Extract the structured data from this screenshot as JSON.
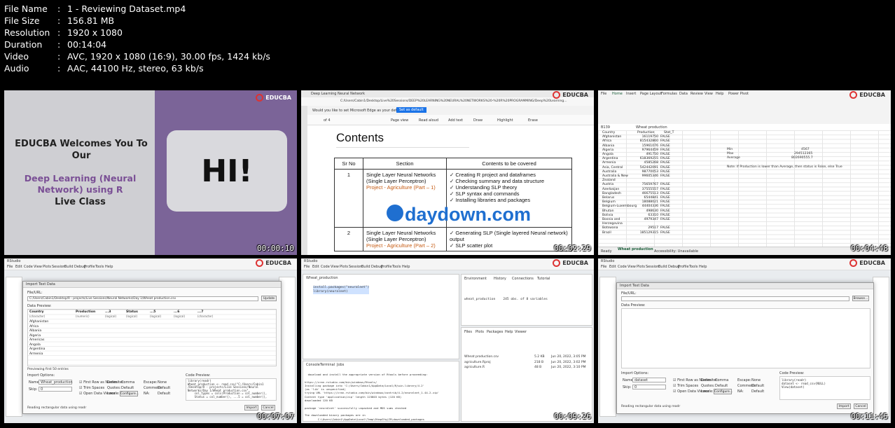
{
  "file_info": [
    {
      "key": "File Name",
      "value": "1 - Reviewing Dataset.mp4"
    },
    {
      "key": "File Size",
      "value": "156.81 MB"
    },
    {
      "key": "Resolution",
      "value": "1920 x 1080"
    },
    {
      "key": "Duration",
      "value": "00:14:04"
    },
    {
      "key": "Video",
      "value": "AVC, 1920 x 1080 (16:9), 30.00 fps, 1424 kb/s"
    },
    {
      "key": "Audio",
      "value": "AAC, 44100 Hz, stereo, 63 kb/s"
    }
  ],
  "separator": ":",
  "brand": "EDUCBA",
  "thumbnails": [
    {
      "timestamp": "00:00:10",
      "welcome": "EDUCBA Welcomes You To Our",
      "course": "Deep Learning (Neural Network) using R",
      "subtitle": "Live Class",
      "hi": "HI!"
    },
    {
      "timestamp": "00:02:29",
      "tab_title": "Deep Learning Neural Network",
      "address": "C:/Users/Cabin1/Desktop/Live%20Sessions/DEEP%20LEARNING%20NEURAL%20NETWORKS%20-%20R%20PROGRAMMING/Deep%20Learning...",
      "edge_notice": "Would you like to set Microsoft Edge as your default browser?",
      "set_default": "Set as default",
      "pdf_tools": [
        "of 4",
        "Page view",
        "Read aloud",
        "Add text",
        "Draw",
        "Highlight",
        "Erase"
      ],
      "heading": "Contents",
      "table_headers": [
        "Sr No",
        "Section",
        "Contents to be covered"
      ],
      "rows": [
        {
          "sr": "1",
          "section": "Single Layer Neural Networks (Single Layer Perceptron)",
          "section_link": "Project - Agriculture (Part – 1)",
          "contents": [
            "Creating R project and dataframes",
            "Checking summary and data structure",
            "Understanding SLP theory",
            "SLP syntax and commands",
            "Installing libraries and packages"
          ]
        },
        {
          "sr": "2",
          "section": "Single Layer Neural Networks (Single Layer Perceptron)",
          "section_link": "Project - Agriculture (Part – 2)",
          "contents": [
            "Generating SLP (Single layered Neural network) output",
            "SLP scatter plot"
          ]
        }
      ],
      "watermark": "daydown.com"
    },
    {
      "timestamp": "00:04:48",
      "ribbon_tabs": [
        "File",
        "Home",
        "Insert",
        "Page Layout",
        "Formulas",
        "Data",
        "Review",
        "View",
        "Help",
        "Power Pivot"
      ],
      "cell_ref": "B139",
      "formula": "Wheat production",
      "col_headers": [
        "Country",
        "Production",
        "Stat_T",
        "Stat",
        "Min",
        "Max",
        "Average"
      ],
      "countries": [
        "Afghanistan",
        "Africa",
        "Albania",
        "Algeria",
        "Angola",
        "Argentina",
        "Armenia",
        "Asia, Central",
        "Australia",
        "Australia & New Zealand",
        "Austria",
        "Azerbaijan",
        "Bangladesh",
        "Belarus",
        "Belgium",
        "Belgium-Luxembourg",
        "Bhutan",
        "Bolivia",
        "Bosnia and Herzegovina",
        "Botswana",
        "Brazil"
      ],
      "values": [
        "16119750",
        "815432860",
        "15961076",
        "97964459",
        "491750",
        "618369255",
        "4585268",
        "542442091",
        "98770053",
        "99605346",
        "75659767",
        "37555557",
        "46675513",
        "6544841",
        "18088021",
        "44404336",
        "498630",
        "63310",
        "4979347",
        "29517",
        "185129315"
      ],
      "flag": "FALSE",
      "stat_min": "Min",
      "stat_max": "Max",
      "stat_avg": "Average",
      "min_val": "4567",
      "max_val": "294512365",
      "avg_val": "802690555.7",
      "note": "Note: If Production is lower than Average, then status is False, else True",
      "sheet_tab": "Wheat production",
      "status_left": "Ready",
      "status_right": "Accessibility: Unavailable"
    },
    {
      "timestamp": "00:07:07",
      "dialog_title": "Import Text Data",
      "file_url_label": "File/URL:",
      "file_path": "C:/Users/Cabin1/Desktop/R - projects/Live Sessions/Neural Networks/Day 1/Wheat production.csv",
      "update": "Update",
      "preview_label": "Data Preview:",
      "preview_cols": [
        "Country",
        "Production",
        "...3",
        "Status",
        "...5",
        "...6",
        "...7"
      ],
      "preview_types": [
        "(character)",
        "(numeric)",
        "(logical)",
        "(logical)",
        "(logical)",
        "(logical)",
        "(character)"
      ],
      "preview_rows": [
        "Afghanistan",
        "Africa",
        "Albania",
        "Algeria",
        "Americas",
        "Angola",
        "Argentina",
        "Armenia"
      ],
      "preview_count": "Previewing first 50 entries",
      "import_options": "Import Options:",
      "name_label": "Name:",
      "name_value": "Wheat_production",
      "skip_label": "Skip:",
      "skip_value": "0",
      "checkbox_labels": [
        "First Row as Names",
        "Trim Spaces",
        "Open Data Viewer"
      ],
      "delimiter_label": "Delimiter:",
      "delimiter_value": "Comma",
      "quotes_label": "Quotes:",
      "quotes_value": "Default",
      "locale_label": "Locale:",
      "configure": "Configure...",
      "escape_label": "Escape:",
      "escape_value": "None",
      "comment_label": "Comment:",
      "comment_value": "Default",
      "na_label": "NA:",
      "na_value": "Default",
      "code_preview_label": "Code Preview:",
      "code": "library(readr)\nWheat_production <- read_csv(\"C:/Users/Cabin1\n/Desktop/R - projects/Live Sessions/Neural\nNetworks/Day 1/Wheat production.csv\",\n    col_types = cols(Production = col_number(),\n    Status = col_number(), ...5 = col_number(),",
      "reading_note": "Reading rectangular data using readr",
      "import": "Import",
      "cancel": "Cancel"
    },
    {
      "timestamp": "00:09:26",
      "script_tab": "Wheat_production",
      "script_code": "install.packages(\"neuralnet\")\nlibrary(neuralnet)",
      "env_tabs": [
        "Environment",
        "History",
        "Connections",
        "Tutorial"
      ],
      "env_data": "wheat_production    245 obs. of 8 variables",
      "files_tabs": [
        "Files",
        "Plots",
        "Packages",
        "Help",
        "Viewer"
      ],
      "files": [
        {
          "name": "Wheat production.csv",
          "size": "5.2 KB",
          "date": "Jun 20, 2022, 3:05 PM"
        },
        {
          "name": "agriculture.Rproj",
          "size": "218 B",
          "date": "Jun 20, 2022, 3:02 PM"
        },
        {
          "name": "agriculture.R",
          "size": "48 B",
          "date": "Jun 20, 2022, 3:10 PM"
        }
      ],
      "console_tabs": [
        "Console",
        "Terminal",
        "Jobs"
      ],
      "console": "  download and install the appropriate version of Rtools before proceeding:\n\nhttps://cran.rstudio.com/bin/windows/Rtools/\nInstalling package into 'C:/Users/Cabin1/AppData/Local/R/win-library/4.2'\n(as 'lib' is unspecified)\ntrying URL 'https://cran.rstudio.com/bin/windows/contrib/4.2/neuralnet_1.44.2.zip'\nContent type 'application/zip' length 123803 bytes (120 KB)\ndownloaded 120 KB\n\npackage 'neuralnet' successfully unpacked and MD5 sums checked\n\nThe downloaded binary packages are in\n        C:\\Users\\Cabin1\\AppData\\Local\\Temp\\RtmpGYqjZ9\\downloaded_packages"
    },
    {
      "timestamp": "00:11:45",
      "dialog_title": "Import Text Data",
      "file_url_label": "File/URL:",
      "browse": "Browse...",
      "preview_label": "Data Preview:",
      "import_options": "Import Options:",
      "name_label": "Name:",
      "name_value": "dataset",
      "skip_label": "Skip:",
      "skip_value": "0",
      "checkbox_labels": [
        "First Row as Names",
        "Trim Spaces",
        "Open Data Viewer"
      ],
      "delimiter_label": "Delimiter:",
      "delimiter_value": "Comma",
      "quotes_label": "Quotes:",
      "quotes_value": "Default",
      "locale_label": "Locale:",
      "configure": "Configure...",
      "escape_label": "Escape:",
      "escape_value": "None",
      "comment_label": "Comment:",
      "comment_value": "Default",
      "na_label": "NA:",
      "na_value": "Default",
      "code_preview_label": "Code Preview:",
      "code": "library(readr)\ndataset <- read_csv(NULL)\nView(dataset)",
      "reading_note": "Reading rectangular data using readr",
      "import": "Import",
      "cancel": "Cancel"
    }
  ],
  "rstudio_menu": [
    "File",
    "Edit",
    "Code",
    "View",
    "Plots",
    "Session",
    "Build",
    "Debug",
    "Profile",
    "Tools",
    "Help"
  ]
}
